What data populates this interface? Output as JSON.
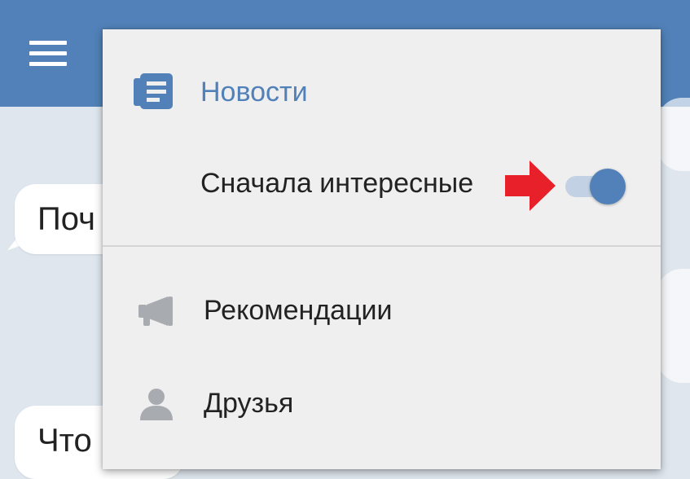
{
  "background": {
    "bubbles": [
      {
        "text": "Поч"
      },
      {
        "text": "Что"
      }
    ]
  },
  "menu": {
    "section": {
      "label": "Новости",
      "icon": "newspaper-icon"
    },
    "toggle": {
      "label": "Сначала интересные",
      "on": true
    },
    "items": [
      {
        "label": "Рекомендации",
        "icon": "megaphone-icon"
      },
      {
        "label": "Друзья",
        "icon": "person-icon"
      }
    ]
  },
  "colors": {
    "accent": "#5181b8",
    "annotation_arrow": "#e8202a",
    "icon_gray": "#a8abb0"
  }
}
